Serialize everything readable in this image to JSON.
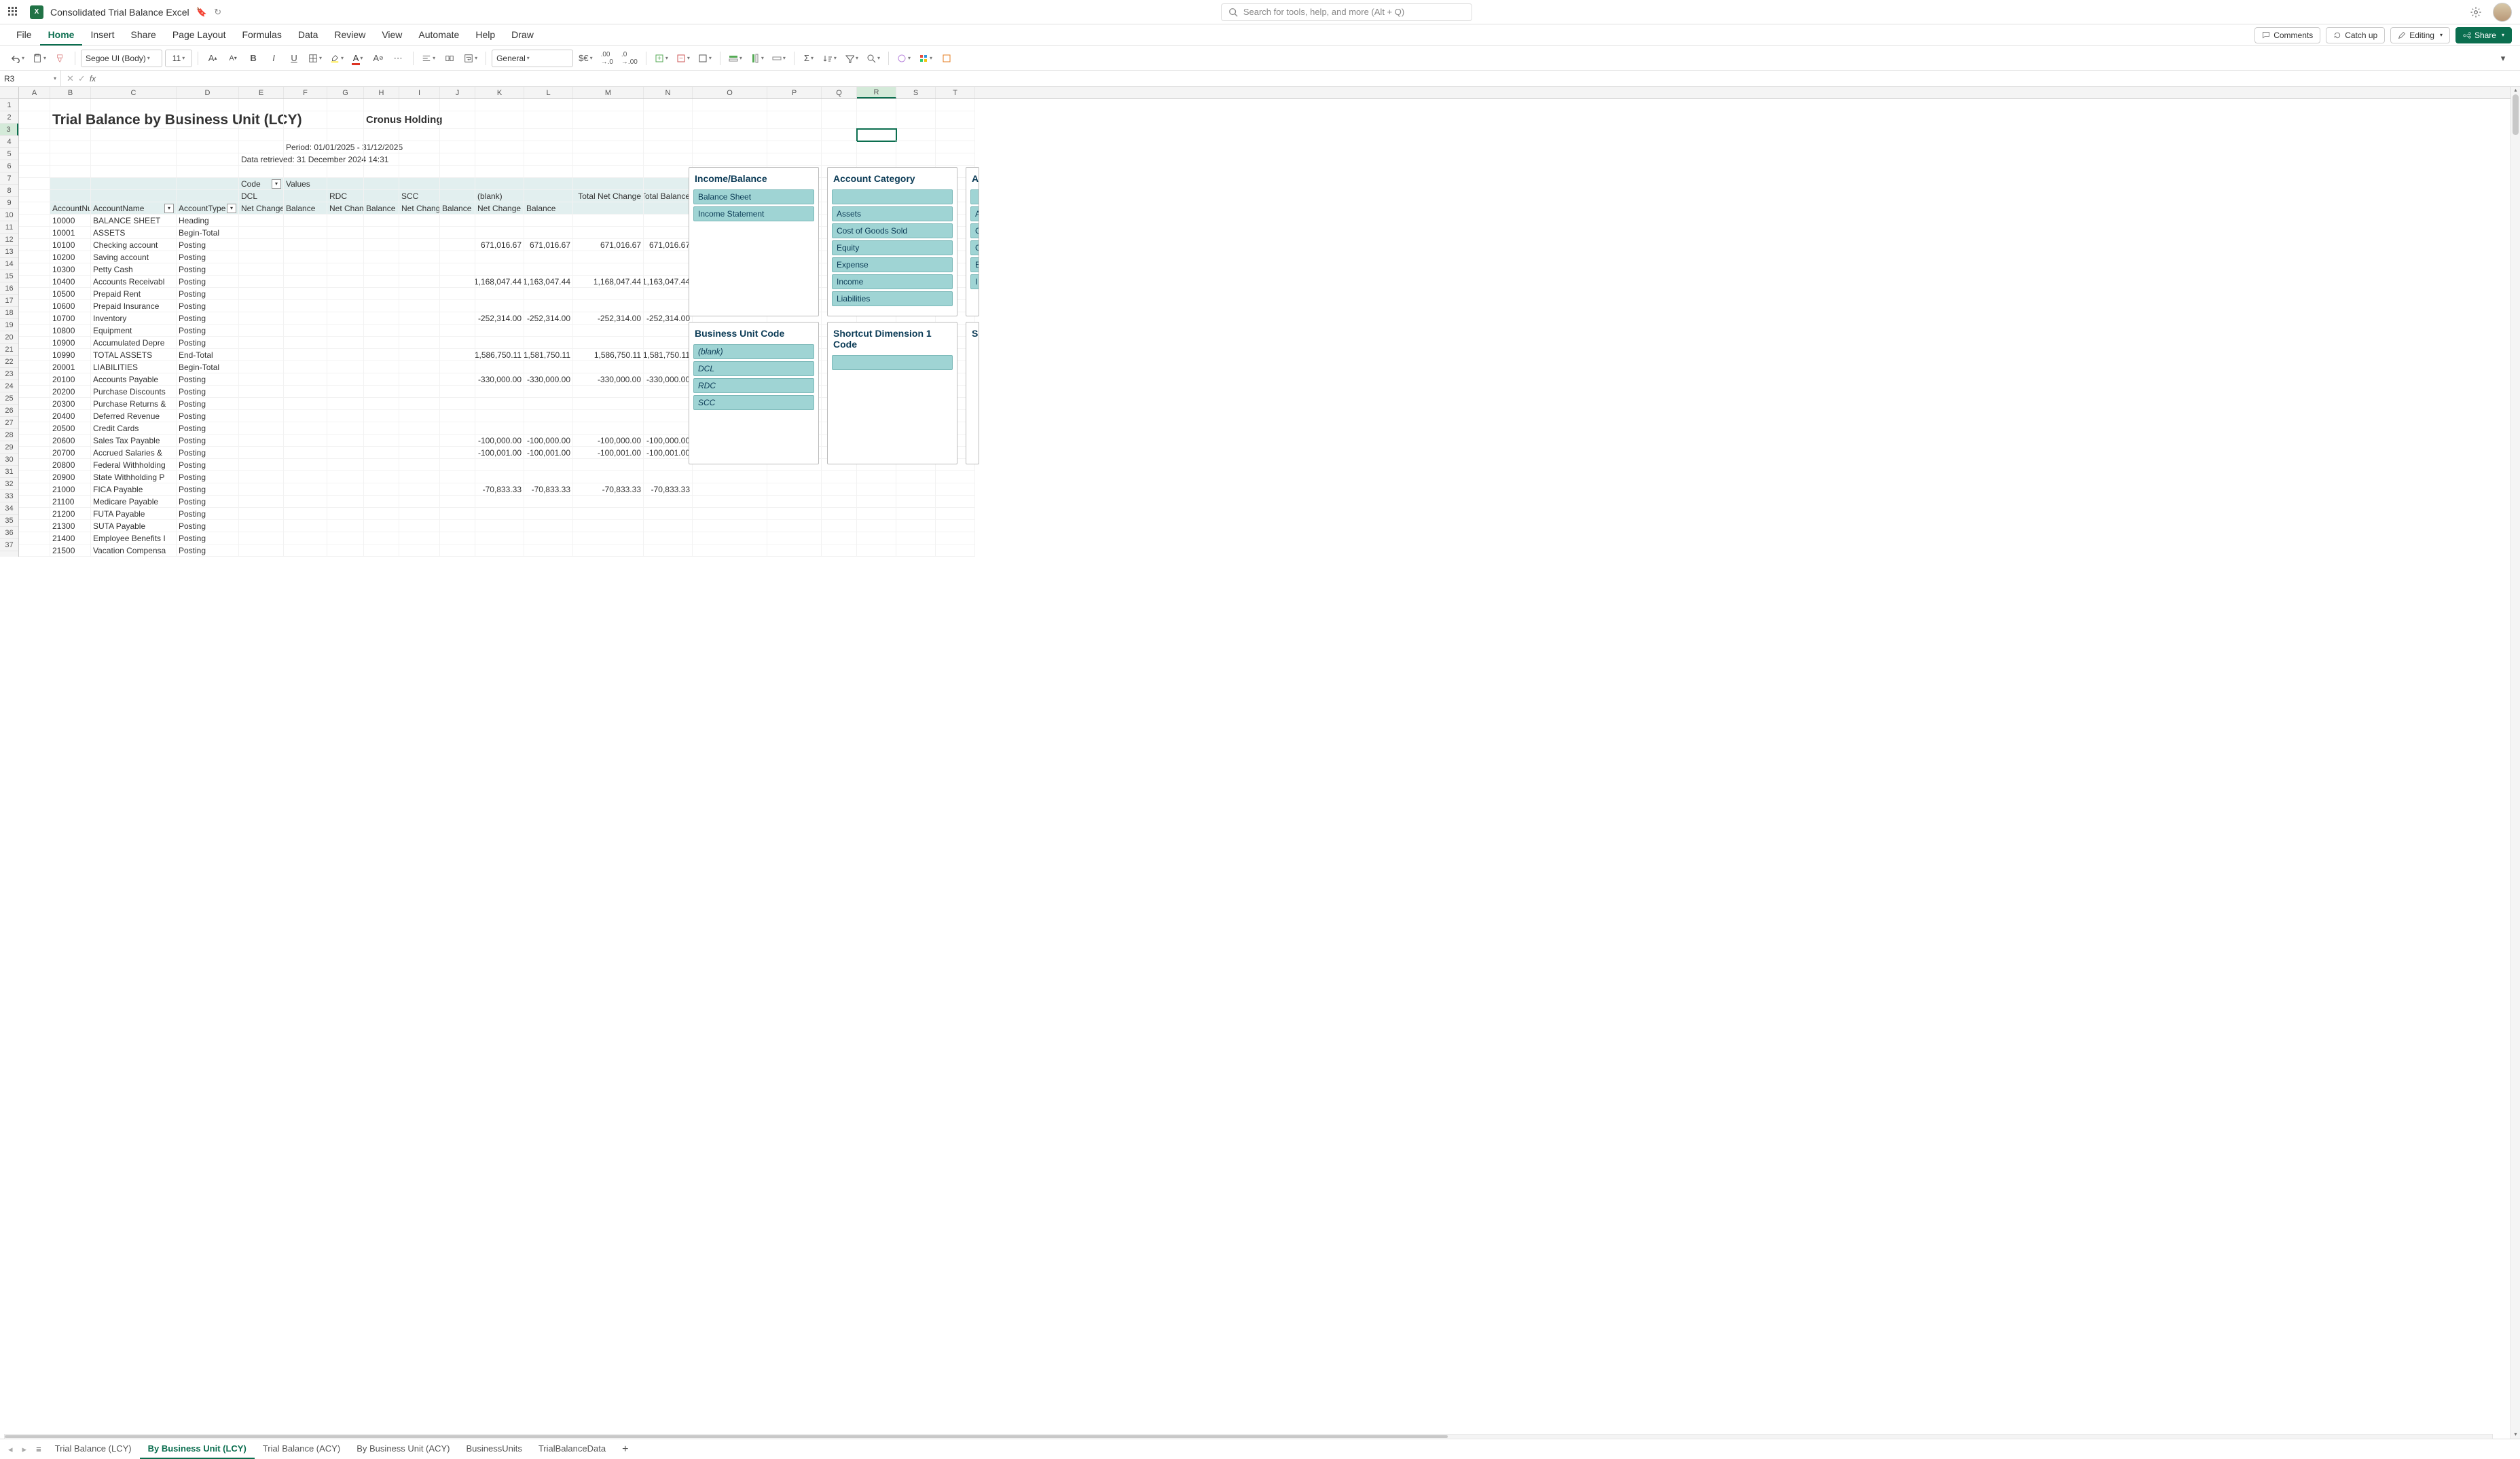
{
  "app": {
    "doc_title": "Consolidated Trial Balance Excel",
    "search_placeholder": "Search for tools, help, and more (Alt + Q)"
  },
  "menubar": {
    "items": [
      "File",
      "Home",
      "Insert",
      "Share",
      "Page Layout",
      "Formulas",
      "Data",
      "Review",
      "View",
      "Automate",
      "Help",
      "Draw"
    ],
    "active_index": 1,
    "comments": "Comments",
    "catchup": "Catch up",
    "editing": "Editing",
    "share": "Share"
  },
  "toolbar": {
    "font_name": "Segoe UI (Body)",
    "font_size": "11",
    "number_format": "General"
  },
  "formula_bar": {
    "name_box": "R3",
    "formula": ""
  },
  "columns": [
    {
      "l": "A",
      "w": 46
    },
    {
      "l": "B",
      "w": 60
    },
    {
      "l": "C",
      "w": 126
    },
    {
      "l": "D",
      "w": 92
    },
    {
      "l": "E",
      "w": 66
    },
    {
      "l": "F",
      "w": 64
    },
    {
      "l": "G",
      "w": 54
    },
    {
      "l": "H",
      "w": 52
    },
    {
      "l": "I",
      "w": 60
    },
    {
      "l": "J",
      "w": 52
    },
    {
      "l": "K",
      "w": 72
    },
    {
      "l": "L",
      "w": 72
    },
    {
      "l": "M",
      "w": 104
    },
    {
      "l": "N",
      "w": 72
    },
    {
      "l": "O",
      "w": 110
    },
    {
      "l": "P",
      "w": 80
    },
    {
      "l": "Q",
      "w": 52
    },
    {
      "l": "R",
      "w": 58
    },
    {
      "l": "S",
      "w": 58
    },
    {
      "l": "T",
      "w": 58
    }
  ],
  "selected_col_index": 17,
  "selected_row": 3,
  "report": {
    "title": "Trial Balance by Business Unit (LCY)",
    "company": "Cronus Holding",
    "period": "Period: 01/01/2025 - 31/12/2025",
    "retrieved": "Data retrieved: 31 December 2024 14:31"
  },
  "pivot_headers": {
    "code_label": "Code",
    "values_label": "Values",
    "bu_codes": [
      "DCL",
      "RDC",
      "SCC",
      "(blank)"
    ],
    "value_cols": [
      "Net Change",
      "Balance"
    ],
    "total_net_change": "Total Net Change",
    "total_balance": "Total Balance",
    "row_field_1": "AccountNu",
    "row_field_2": "AccountName",
    "row_field_3": "AccountType"
  },
  "rows": [
    {
      "r": 10,
      "no": "10000",
      "name": "BALANCE SHEET",
      "type": "Heading"
    },
    {
      "r": 11,
      "no": "10001",
      "name": "ASSETS",
      "type": "Begin-Total"
    },
    {
      "r": 12,
      "no": "10100",
      "name": "Checking account",
      "type": "Posting",
      "bK": "671,016.67",
      "bL": "671,016.67",
      "bM": "671,016.67",
      "bN": "671,016.67"
    },
    {
      "r": 13,
      "no": "10200",
      "name": "Saving account",
      "type": "Posting"
    },
    {
      "r": 14,
      "no": "10300",
      "name": "Petty Cash",
      "type": "Posting"
    },
    {
      "r": 15,
      "no": "10400",
      "name": "Accounts Receivabl",
      "type": "Posting",
      "bK": "1,168,047.44",
      "bL": "1,163,047.44",
      "bM": "1,168,047.44",
      "bN": "1,163,047.44"
    },
    {
      "r": 16,
      "no": "10500",
      "name": "Prepaid Rent",
      "type": "Posting"
    },
    {
      "r": 17,
      "no": "10600",
      "name": "Prepaid Insurance",
      "type": "Posting"
    },
    {
      "r": 18,
      "no": "10700",
      "name": "Inventory",
      "type": "Posting",
      "bK": "-252,314.00",
      "bL": "-252,314.00",
      "bM": "-252,314.00",
      "bN": "-252,314.00"
    },
    {
      "r": 19,
      "no": "10800",
      "name": "Equipment",
      "type": "Posting"
    },
    {
      "r": 20,
      "no": "10900",
      "name": "Accumulated Depre",
      "type": "Posting"
    },
    {
      "r": 21,
      "no": "10990",
      "name": "TOTAL ASSETS",
      "type": "End-Total",
      "bK": "1,586,750.11",
      "bL": "1,581,750.11",
      "bM": "1,586,750.11",
      "bN": "1,581,750.11"
    },
    {
      "r": 22,
      "no": "20001",
      "name": "LIABILITIES",
      "type": "Begin-Total"
    },
    {
      "r": 23,
      "no": "20100",
      "name": "Accounts Payable",
      "type": "Posting",
      "bK": "-330,000.00",
      "bL": "-330,000.00",
      "bM": "-330,000.00",
      "bN": "-330,000.00"
    },
    {
      "r": 24,
      "no": "20200",
      "name": "Purchase Discounts",
      "type": "Posting"
    },
    {
      "r": 25,
      "no": "20300",
      "name": "Purchase Returns &",
      "type": "Posting"
    },
    {
      "r": 26,
      "no": "20400",
      "name": "Deferred Revenue",
      "type": "Posting"
    },
    {
      "r": 27,
      "no": "20500",
      "name": "Credit Cards",
      "type": "Posting"
    },
    {
      "r": 28,
      "no": "20600",
      "name": "Sales Tax Payable",
      "type": "Posting",
      "bK": "-100,000.00",
      "bL": "-100,000.00",
      "bM": "-100,000.00",
      "bN": "-100,000.00"
    },
    {
      "r": 29,
      "no": "20700",
      "name": "Accrued Salaries &",
      "type": "Posting",
      "bK": "-100,001.00",
      "bL": "-100,001.00",
      "bM": "-100,001.00",
      "bN": "-100,001.00"
    },
    {
      "r": 30,
      "no": "20800",
      "name": "Federal Withholding",
      "type": "Posting"
    },
    {
      "r": 31,
      "no": "20900",
      "name": "State Withholding P",
      "type": "Posting"
    },
    {
      "r": 32,
      "no": "21000",
      "name": "FICA Payable",
      "type": "Posting",
      "bK": "-70,833.33",
      "bL": "-70,833.33",
      "bM": "-70,833.33",
      "bN": "-70,833.33"
    },
    {
      "r": 33,
      "no": "21100",
      "name": "Medicare Payable",
      "type": "Posting"
    },
    {
      "r": 34,
      "no": "21200",
      "name": "FUTA Payable",
      "type": "Posting"
    },
    {
      "r": 35,
      "no": "21300",
      "name": "SUTA Payable",
      "type": "Posting"
    },
    {
      "r": 36,
      "no": "21400",
      "name": "Employee Benefits I",
      "type": "Posting"
    },
    {
      "r": 37,
      "no": "21500",
      "name": "Vacation Compensa",
      "type": "Posting"
    }
  ],
  "slicers": {
    "income_balance": {
      "title": "Income/Balance",
      "items": [
        "Balance Sheet",
        "Income Statement"
      ]
    },
    "account_category": {
      "title": "Account Category",
      "items": [
        "",
        "Assets",
        "Cost of Goods Sold",
        "Equity",
        "Expense",
        "Income",
        "Liabilities"
      ]
    },
    "business_unit": {
      "title": "Business Unit Code",
      "items": [
        "(blank)",
        "DCL",
        "RDC",
        "SCC"
      ]
    },
    "dim1": {
      "title": "Shortcut Dimension 1 Code",
      "items": [
        ""
      ]
    },
    "partial1": {
      "title": "A",
      "items": [
        "",
        "A",
        "C",
        "C",
        "E",
        "I"
      ]
    },
    "partial2": {
      "title": "Sh"
    }
  },
  "sheet_tabs": {
    "tabs": [
      "Trial Balance (LCY)",
      "By Business Unit (LCY)",
      "Trial Balance (ACY)",
      "By Business Unit (ACY)",
      "BusinessUnits",
      "TrialBalanceData"
    ],
    "active_index": 1
  }
}
